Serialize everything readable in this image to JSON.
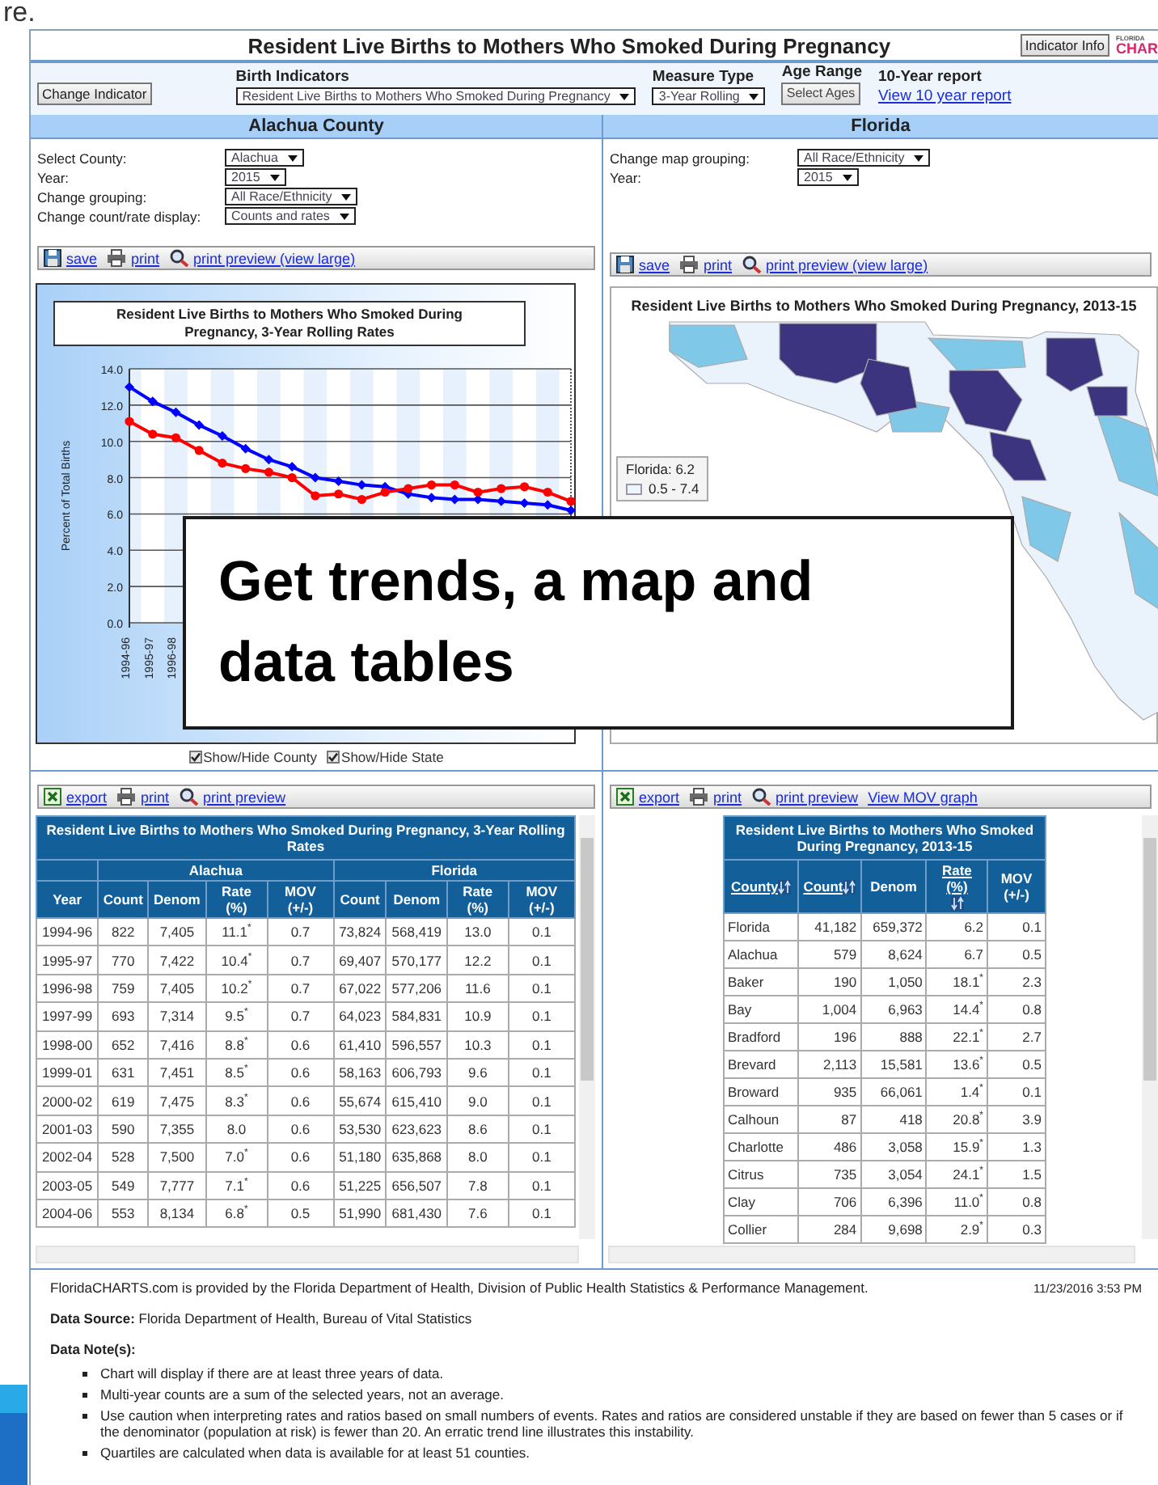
{
  "slide": {
    "heading_fragment": "re.",
    "callout": "Get trends, a map and data tables"
  },
  "header": {
    "title": "Resident Live Births to Mothers Who Smoked During Pregnancy",
    "info_button": "Indicator Info",
    "logo": {
      "small": "FLORIDA",
      "large": "CHAR"
    }
  },
  "indicator_bar": {
    "change_button": "Change Indicator",
    "fields": [
      {
        "label": "Birth Indicators",
        "kind": "select",
        "value": "Resident Live Births to Mothers Who Smoked During Pregnancy"
      },
      {
        "label": "Measure Type",
        "kind": "select",
        "value": "3-Year Rolling"
      },
      {
        "label": "Age Range",
        "kind": "button",
        "value": "Select Ages"
      },
      {
        "label": "10-Year report",
        "kind": "link",
        "value": "View 10 year report"
      }
    ]
  },
  "county_panel": {
    "heading": "Alachua County",
    "controls": [
      {
        "label": "Select County:",
        "value": "Alachua"
      },
      {
        "label": "Year:",
        "value": "2015"
      },
      {
        "label": "Change grouping:",
        "value": "All Race/Ethnicity"
      },
      {
        "label": "Change count/rate display:",
        "value": "Counts and rates"
      }
    ],
    "toolbar": [
      {
        "kind": "save",
        "label": "save"
      },
      {
        "kind": "print",
        "label": "print"
      },
      {
        "kind": "preview",
        "label": "print preview (view large)"
      }
    ],
    "chart_data": {
      "type": "line",
      "grid": true,
      "title": "Resident Live Births to Mothers Who Smoked During Pregnancy, 3-Year Rolling Rates",
      "ylabel": "Percent of Total Births",
      "categories": [
        "1994-96",
        "1995-97",
        "1996-98",
        null,
        null,
        null,
        null,
        null,
        null,
        null,
        null,
        null,
        null,
        null,
        null,
        null,
        null,
        null,
        null,
        null
      ],
      "series": [
        {
          "color": "#0000ff",
          "marker": "diamond",
          "values": [
            13.0,
            12.2,
            11.6,
            10.9,
            10.3,
            9.6,
            9.0,
            8.6,
            8.0,
            7.8,
            7.6,
            7.5,
            7.1,
            6.9,
            6.8,
            6.8,
            6.7,
            6.6,
            6.5,
            6.2
          ]
        },
        {
          "color": "#ff0000",
          "marker": "circle",
          "values": [
            11.1,
            10.4,
            10.2,
            9.5,
            8.8,
            8.5,
            8.3,
            8.0,
            7.0,
            7.1,
            6.8,
            7.2,
            7.4,
            7.6,
            7.6,
            7.2,
            7.4,
            7.5,
            7.2,
            6.7
          ]
        }
      ],
      "ylim": [
        0,
        14
      ],
      "yticks": [
        {
          "value": 0,
          "label": "0.0"
        },
        {
          "value": 2,
          "label": "2.0"
        },
        {
          "value": 4,
          "label": "4.0"
        },
        {
          "value": 6,
          "label": "6.0"
        },
        {
          "value": 8,
          "label": "8.0"
        },
        {
          "value": 10,
          "label": "10.0"
        },
        {
          "value": 12,
          "label": "12.0"
        },
        {
          "value": 14,
          "label": "14.0"
        }
      ]
    },
    "toggles": [
      {
        "label": "Show/Hide County",
        "checked": true
      },
      {
        "label": "Show/Hide State",
        "checked": true
      }
    ],
    "table_toolbar": [
      {
        "kind": "export",
        "label": "export"
      },
      {
        "kind": "print",
        "label": "print"
      },
      {
        "kind": "preview",
        "label": "print preview"
      }
    ],
    "table": {
      "title": "Resident Live Births to Mothers Who Smoked During Pregnancy, 3-Year Rolling Rates",
      "groups": [
        "Alachua",
        "Florida"
      ],
      "columns": [
        "Year",
        "Count",
        "Denom",
        "Rate (%)",
        "MOV (+/-)",
        "Count",
        "Denom",
        "Rate (%)",
        "MOV (+/-)"
      ],
      "rows": [
        [
          "1994-96",
          "822",
          "7,405",
          "11.1$^{*}$",
          "0.7",
          "73,824",
          "568,419",
          "13.0",
          "0.1"
        ],
        [
          "1995-97",
          "770",
          "7,422",
          "10.4$^{*}$",
          "0.7",
          "69,407",
          "570,177",
          "12.2",
          "0.1"
        ],
        [
          "1996-98",
          "759",
          "7,405",
          "10.2$^{*}$",
          "0.7",
          "67,022",
          "577,206",
          "11.6",
          "0.1"
        ],
        [
          "1997-99",
          "693",
          "7,314",
          "9.5$^{*}$",
          "0.7",
          "64,023",
          "584,831",
          "10.9",
          "0.1"
        ],
        [
          "1998-00",
          "652",
          "7,416",
          "8.8$^{*}$",
          "0.6",
          "61,410",
          "596,557",
          "10.3",
          "0.1"
        ],
        [
          "1999-01",
          "631",
          "7,451",
          "8.5$^{*}$",
          "0.6",
          "58,163",
          "606,793",
          "9.6",
          "0.1"
        ],
        [
          "2000-02",
          "619",
          "7,475",
          "8.3$^{*}$",
          "0.6",
          "55,674",
          "615,410",
          "9.0",
          "0.1"
        ],
        [
          "2001-03",
          "590",
          "7,355",
          "8.0",
          "0.6",
          "53,530",
          "623,623",
          "8.6",
          "0.1"
        ],
        [
          "2002-04",
          "528",
          "7,500",
          "7.0$^{*}$",
          "0.6",
          "51,180",
          "635,868",
          "8.0",
          "0.1"
        ],
        [
          "2003-05",
          "549",
          "7,777",
          "7.1$^{*}$",
          "0.6",
          "51,225",
          "656,507",
          "7.8",
          "0.1"
        ],
        [
          "2004-06",
          "553",
          "8,134",
          "6.8$^{*}$",
          "0.5",
          "51,990",
          "681,430",
          "7.6",
          "0.1"
        ]
      ]
    }
  },
  "state_panel": {
    "heading": "Florida",
    "controls": [
      {
        "label": "Change map grouping:",
        "value": "All Race/Ethnicity"
      },
      {
        "label": "Year:",
        "value": "2015"
      }
    ],
    "toolbar": [
      {
        "kind": "save",
        "label": "save"
      },
      {
        "kind": "print",
        "label": "print"
      },
      {
        "kind": "preview",
        "label": "print preview (view large)"
      }
    ],
    "map": {
      "title": "Resident Live Births to Mothers Who Smoked During Pregnancy, 2013-15",
      "legend": {
        "title": "Florida: 6.2",
        "items": [
          {
            "label": "0.5 - 7.4",
            "color": "#eef5fc"
          }
        ]
      }
    },
    "table_toolbar": [
      {
        "kind": "export",
        "label": "export"
      },
      {
        "kind": "print",
        "label": "print"
      },
      {
        "kind": "preview",
        "label": "print preview"
      },
      {
        "kind": "link",
        "label": "View MOV graph"
      }
    ],
    "table": {
      "title": "Resident Live Births to Mothers Who Smoked During Pregnancy, 2013-15",
      "columns": [
        {
          "label": "County",
          "sortable": true
        },
        {
          "label": "Count",
          "sortable": true
        },
        {
          "label": "Denom",
          "sortable": false
        },
        {
          "label": "Rate (%)",
          "sortable": true
        },
        {
          "label": "MOV (+/-)",
          "sortable": false
        }
      ],
      "rows": [
        [
          "Florida",
          "41,182",
          "659,372",
          "6.2",
          "0.1"
        ],
        [
          "Alachua",
          "579",
          "8,624",
          "6.7",
          "0.5"
        ],
        [
          "Baker",
          "190",
          "1,050",
          "18.1$^{*}$",
          "2.3"
        ],
        [
          "Bay",
          "1,004",
          "6,963",
          "14.4$^{*}$",
          "0.8"
        ],
        [
          "Bradford",
          "196",
          "888",
          "22.1$^{*}$",
          "2.7"
        ],
        [
          "Brevard",
          "2,113",
          "15,581",
          "13.6$^{*}$",
          "0.5"
        ],
        [
          "Broward",
          "935",
          "66,061",
          "1.4$^{*}$",
          "0.1"
        ],
        [
          "Calhoun",
          "87",
          "418",
          "20.8$^{*}$",
          "3.9"
        ],
        [
          "Charlotte",
          "486",
          "3,058",
          "15.9$^{*}$",
          "1.3"
        ],
        [
          "Citrus",
          "735",
          "3,054",
          "24.1$^{*}$",
          "1.5"
        ],
        [
          "Clay",
          "706",
          "6,396",
          "11.0$^{*}$",
          "0.8"
        ],
        [
          "Collier",
          "284",
          "9,698",
          "2.9$^{*}$",
          "0.3"
        ]
      ]
    }
  },
  "footer": {
    "provider": "FloridaCHARTS.com is provided by the Florida Department of Health, Division of Public Health Statistics & Performance Management.",
    "timestamp": "11/23/2016 3:53 PM",
    "source": "**Data Source:** Florida Department of Health, Bureau of Vital Statistics",
    "notes_heading": "Data Note(s):",
    "notes": [
      "Chart will display if there are at least three years of data.",
      "Multi-year counts are a sum of the selected years, not an average.",
      "Use caution when interpreting rates and ratios based on small numbers of events. Rates and ratios are considered unstable if they are based on fewer than 5 cases or if the denominator (population at risk) is fewer than 20. An erratic trend line illustrates this instability.",
      "Quartiles are calculated when data is available for at least 51 counties."
    ]
  }
}
